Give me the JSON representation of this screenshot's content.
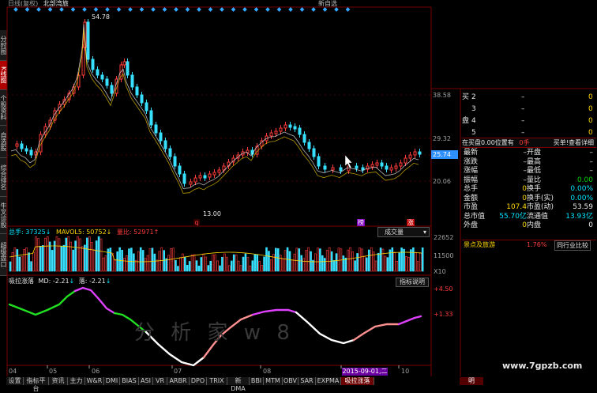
{
  "header": {
    "title_left": "日线(复权)",
    "title_mid": "北部湾旅",
    "title_right": "新自选"
  },
  "left_tabs": [
    {
      "label": "分时图",
      "active": false
    },
    {
      "label": "K线图",
      "active": true
    },
    {
      "label": "个股资料",
      "active": false
    },
    {
      "label": "自选股",
      "active": false
    },
    {
      "label": "综合排名",
      "active": false
    },
    {
      "label": "牛叉诊股",
      "active": false
    },
    {
      "label": "超级盘口",
      "active": false
    }
  ],
  "price_chart": {
    "high_label": "54.78",
    "low_label": "13.00",
    "axis_labels": [
      "38.58",
      "29.32",
      "25.74",
      "20.06"
    ],
    "markers": [
      {
        "label": "q",
        "color": "#ff3030"
      },
      {
        "label": "榜",
        "color": "#8000c0"
      },
      {
        "label": "涨",
        "color": "#c00000"
      }
    ]
  },
  "volume_header": {
    "total_label": "总手: 37325",
    "mavol_label": "MAVOL5: 50752",
    "ratio_label": "量比: 52971",
    "selector": "成交量"
  },
  "volume_axis": [
    "22652",
    "11500",
    "X10"
  ],
  "indicator_header": {
    "name": "吸拉涨落",
    "md_label": "MD: -2.21",
    "fall_label": "落: -2.21",
    "explain_button": "指标说明"
  },
  "indicator_axis": [
    "+4.50",
    "+1.33"
  ],
  "watermark": "分  析  家  w  8",
  "date_axis": [
    "04",
    "05",
    "06",
    "07",
    "08",
    "09",
    "10"
  ],
  "date_highlight": "2015-09-01,二",
  "watermark_url": "www.7gpzb.com",
  "order_book": {
    "rows": [
      {
        "side": "买",
        "level": "2",
        "price": "–",
        "vol": "0"
      },
      {
        "side": "",
        "level": "3",
        "price": "–",
        "vol": "0"
      },
      {
        "side": "盘",
        "level": "4",
        "price": "–",
        "vol": "0"
      },
      {
        "side": "",
        "level": "5",
        "price": "–",
        "vol": "0"
      }
    ]
  },
  "buy_bar": {
    "left": "在买盘0.00位置有",
    "mid": "0手",
    "right": "买单!查看详细"
  },
  "quote_rows": [
    {
      "l1": "最新",
      "v1": "–",
      "l2": "开盘",
      "v2": "–"
    },
    {
      "l1": "涨跌",
      "v1": "–",
      "l2": "最高",
      "v2": "–"
    },
    {
      "l1": "涨幅",
      "v1": "–",
      "l2": "最低",
      "v2": "–"
    },
    {
      "l1": "振幅",
      "v1": "–",
      "l2": "量比",
      "v2": "0.00"
    },
    {
      "l1": "总手",
      "v1": "0",
      "l2": "换手",
      "v2": "0.00%"
    },
    {
      "l1": "金额",
      "v1": "0",
      "l2": "换手(实)",
      "v2": "0.00%"
    },
    {
      "l1": "市盈",
      "v1": "107.4",
      "l2": "市盈(动)",
      "v2": "53.59"
    },
    {
      "l1": "总市值",
      "v1": "55.70亿",
      "l2": "流通值",
      "v2": "13.93亿"
    },
    {
      "l1": "外盘",
      "v1": "0",
      "l2": "内盘",
      "v2": "0"
    }
  ],
  "sector": {
    "name": "景点及旅游",
    "pct": "1.76%",
    "compare": "同行业比较"
  },
  "bottom_tabs": [
    {
      "label": "设置",
      "active": false
    },
    {
      "label": "指标平台",
      "active": false
    },
    {
      "label": "资讯",
      "active": false
    },
    {
      "label": "主力",
      "active": false
    },
    {
      "label": "W&R",
      "active": false
    },
    {
      "label": "DMI",
      "active": false
    },
    {
      "label": "BIAS",
      "active": false
    },
    {
      "label": "ASI",
      "active": false
    },
    {
      "label": "VR",
      "active": false
    },
    {
      "label": "ARBR",
      "active": false
    },
    {
      "label": "DPO",
      "active": false
    },
    {
      "label": "TRIX",
      "active": false
    },
    {
      "label": "新DMA",
      "active": false
    },
    {
      "label": "BBI",
      "active": false
    },
    {
      "label": "MTM",
      "active": false
    },
    {
      "label": "OBV",
      "active": false
    },
    {
      "label": "SAR",
      "active": false
    },
    {
      "label": "EXPMA",
      "active": false
    },
    {
      "label": "吸拉涨落",
      "active": true
    }
  ],
  "bottom_right": "明"
}
